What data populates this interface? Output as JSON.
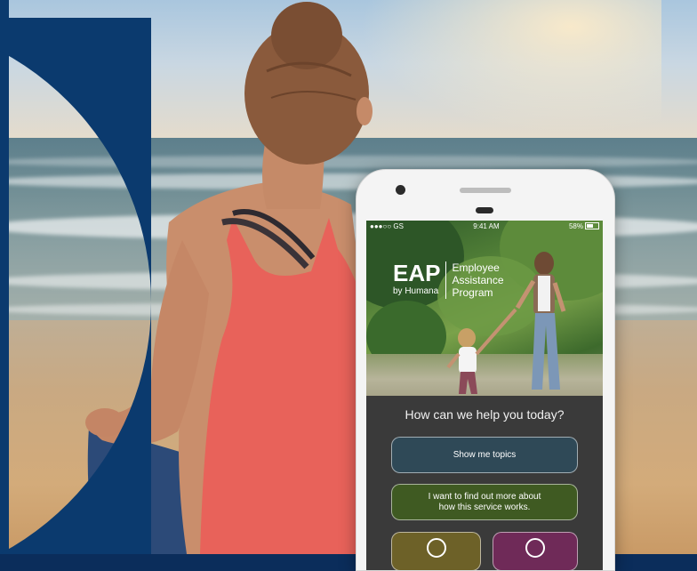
{
  "phone": {
    "status": {
      "carrier": "●●●○○ GS",
      "time": "9:41 AM",
      "battery": "58%"
    },
    "logo": {
      "brand": "EAP",
      "byline": "by Humana",
      "program_line1": "Employee",
      "program_line2": "Assistance",
      "program_line3": "Program"
    },
    "question": "How can we help you today?",
    "buttons": {
      "topics": "Show me topics",
      "learn_more_line1": "I want to find out more about",
      "learn_more_line2": "how this service works."
    },
    "icons": {
      "call": "headset-icon",
      "list": "list-icon"
    }
  },
  "colors": {
    "navy": "#0b3a6e",
    "topics_button": "#2f4957",
    "learn_more_button": "#3f5a22",
    "call_button": "#6d6128",
    "list_button": "#6f2a58"
  }
}
